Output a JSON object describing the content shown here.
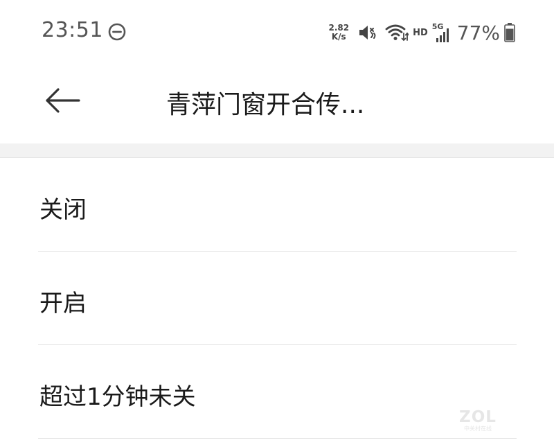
{
  "status_bar": {
    "time": "23:51",
    "net_speed_value": "2.82",
    "net_speed_unit": "K/s",
    "hd_label": "HD",
    "network_type": "5G",
    "battery_percent": "77%",
    "icons": [
      "do-not-disturb-icon",
      "mute-icon",
      "wifi-icon",
      "signal-icon",
      "battery-icon"
    ]
  },
  "header": {
    "title": "青萍门窗开合传..."
  },
  "options": [
    {
      "label": "关闭"
    },
    {
      "label": "开启"
    },
    {
      "label": "超过1分钟未关"
    }
  ],
  "watermark": {
    "logo": "ZOL",
    "subtitle": "中关村在线"
  }
}
